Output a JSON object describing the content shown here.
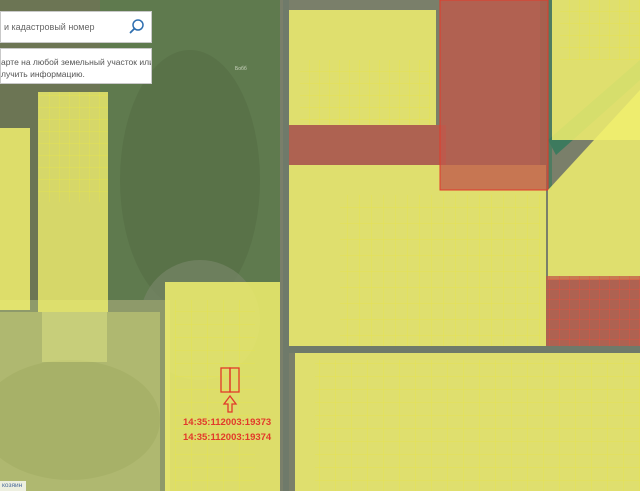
{
  "search": {
    "placeholder": "и кадастровый номер",
    "icon": "search-icon"
  },
  "hint": {
    "text": "арте на любой земельный участок или\nлучить информацию."
  },
  "map": {
    "colors": {
      "parcel_fill": "#f1f06e",
      "parcel_line": "#e6e44a",
      "selected_outline": "#e23a2a",
      "highlight_fill": "#c0584a"
    },
    "area_label": "Бобб",
    "selected_parcels": [
      "14:35:112003:19373",
      "14:35:112003:19374"
    ],
    "arrow_icon": "up-arrow-icon"
  },
  "attribution": "козяин"
}
